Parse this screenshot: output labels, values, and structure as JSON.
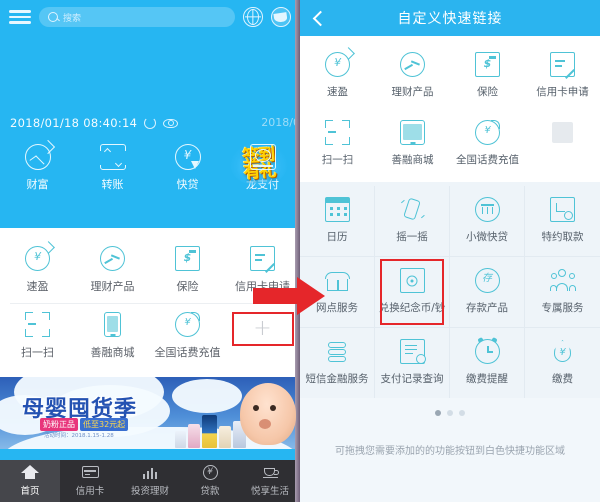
{
  "left": {
    "topbar": {
      "menu_icon": "hamburger-menu-icon",
      "search_placeholder": "搜索",
      "search_value": "",
      "globe_icon": "globe-icon",
      "avatar_icon": "user-avatar-icon"
    },
    "hero": {
      "signin_badge_line1": "签到",
      "signin_badge_line2": "有礼",
      "datetime": "2018/01/18 08:40:14",
      "refresh_icon": "refresh-icon",
      "eye_icon": "eye-toggle-icon",
      "right_date_partial": "2018/0",
      "shortcuts": [
        {
          "label": "财富",
          "icon": "wealth-icon"
        },
        {
          "label": "转账",
          "icon": "transfer-icon"
        },
        {
          "label": "快贷",
          "icon": "quick-loan-icon"
        },
        {
          "label": "龙支付",
          "icon": "long-pay-icon"
        }
      ]
    },
    "quick_card": {
      "row1": [
        {
          "label": "速盈",
          "icon": "suying-icon"
        },
        {
          "label": "理财产品",
          "icon": "wealth-product-icon"
        },
        {
          "label": "保险",
          "icon": "insurance-icon"
        },
        {
          "label": "信用卡申请",
          "icon": "credit-card-apply-icon"
        }
      ],
      "row2": [
        {
          "label": "扫一扫",
          "icon": "scan-icon"
        },
        {
          "label": "善融商城",
          "icon": "mall-icon"
        },
        {
          "label": "全国话费充值",
          "icon": "phone-recharge-icon"
        },
        {
          "label": "+",
          "icon": "add-shortcut-icon"
        }
      ]
    },
    "banner": {
      "title": "母婴囤货季",
      "tag1": "奶粉正品",
      "tag2": "低至32元起",
      "subnote": "活动时间：2018.1.15-1.28"
    },
    "bottom_nav": [
      {
        "label": "首页",
        "icon": "home-icon",
        "active": true
      },
      {
        "label": "信用卡",
        "icon": "credit-card-icon",
        "active": false
      },
      {
        "label": "投资理财",
        "icon": "investment-icon",
        "active": false
      },
      {
        "label": "贷款",
        "icon": "loan-icon",
        "active": false
      },
      {
        "label": "悦享生活",
        "icon": "lifestyle-cup-icon",
        "active": false
      }
    ]
  },
  "right": {
    "header": {
      "title": "自定义快速链接",
      "back_icon": "back-chevron-icon"
    },
    "white_zone": [
      {
        "label": "速盈",
        "icon": "suying-icon"
      },
      {
        "label": "理财产品",
        "icon": "wealth-product-icon"
      },
      {
        "label": "保险",
        "icon": "insurance-icon"
      },
      {
        "label": "信用卡申请",
        "icon": "credit-card-apply-icon"
      },
      {
        "label": "扫一扫",
        "icon": "scan-icon"
      },
      {
        "label": "善融商城",
        "icon": "mall-icon"
      },
      {
        "label": "全国话费充值",
        "icon": "phone-recharge-icon"
      },
      {
        "label": "",
        "icon": "empty-slot-placeholder"
      }
    ],
    "gray_zone_rows": [
      [
        {
          "label": "日历",
          "icon": "calendar-icon",
          "highlight": false
        },
        {
          "label": "摇一摇",
          "icon": "shake-icon",
          "highlight": false
        },
        {
          "label": "小微快贷",
          "icon": "micro-loan-icon",
          "highlight": false
        },
        {
          "label": "特约取款",
          "icon": "special-withdraw-icon",
          "highlight": false
        }
      ],
      [
        {
          "label": "网点服务",
          "icon": "branch-service-icon",
          "highlight": false
        },
        {
          "label": "兑换纪念币/钞",
          "icon": "commemorative-coin-icon",
          "highlight": true
        },
        {
          "label": "存款产品",
          "icon": "deposit-product-icon",
          "highlight": false
        },
        {
          "label": "专属服务",
          "icon": "exclusive-service-icon",
          "highlight": false
        }
      ],
      [
        {
          "label": "短信金融服务",
          "icon": "sms-finance-icon",
          "highlight": false
        },
        {
          "label": "支付记录查询",
          "icon": "payment-record-icon",
          "highlight": false
        },
        {
          "label": "缴费提醒",
          "icon": "payment-reminder-icon",
          "highlight": false
        },
        {
          "label": "缴费",
          "icon": "pay-bill-icon",
          "highlight": false
        }
      ]
    ],
    "pagination": {
      "total": 3,
      "active": 1
    },
    "hint": "可拖拽您需要添加的的功能按钮到白色快捷功能区域"
  },
  "annotation": {
    "arrow_icon": "red-right-arrow",
    "arrow_color": "#e5262a",
    "highlight_color": "#e5262a"
  },
  "colors": {
    "brand_blue": "#26b6f2",
    "header_blue": "#2bb4ef",
    "icon_teal": "#4fc3d6",
    "nav_dark": "#2f2f33",
    "gray_zone": "#eef4f9"
  }
}
